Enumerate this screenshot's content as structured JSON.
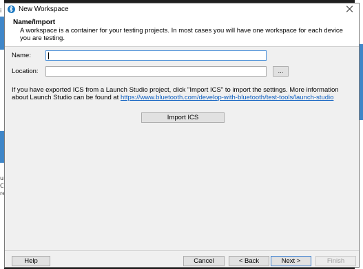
{
  "window": {
    "title": "New Workspace"
  },
  "header": {
    "title": "Name/Import",
    "description": "A workspace is a container for your testing projects. In most cases you will have one workspace for each device you are testing."
  },
  "form": {
    "name_label": "Name:",
    "name_value": "",
    "location_label": "Location:",
    "location_value": "",
    "browse_label": "..."
  },
  "info": {
    "text": "If you have exported ICS from a Launch Studio project, click \"Import ICS\" to import the settings. More information about Launch Studio can be found at ",
    "link": "https://www.bluetooth.com/develop-with-bluetooth/test-tools/launch-studio"
  },
  "import_button": "Import ICS",
  "footer": {
    "help": "Help",
    "cancel": "Cancel",
    "back": "< Back",
    "next": "Next >",
    "finish": "Finish"
  },
  "background_fragments": [
    "i",
    "ui",
    "C",
    "re"
  ],
  "colors": {
    "accent": "#3f86c8",
    "link": "#0b5ec1",
    "focus_border": "#4a90d9"
  }
}
